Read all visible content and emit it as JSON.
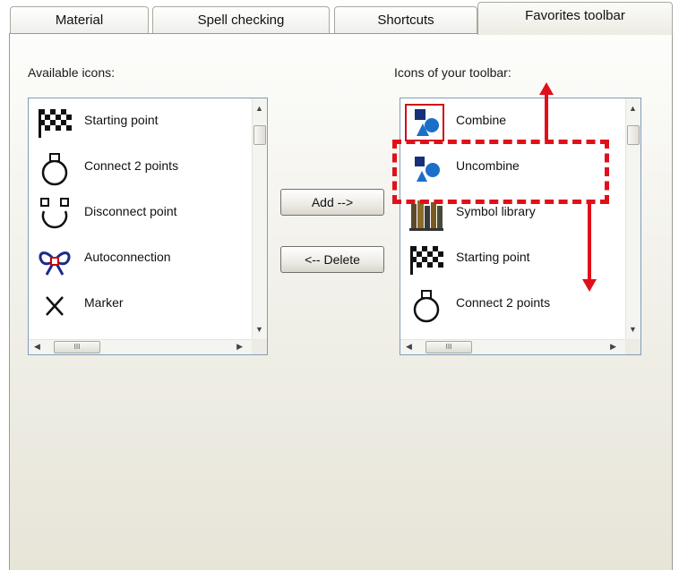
{
  "tabs": [
    {
      "label": "Material",
      "active": false
    },
    {
      "label": "Spell checking",
      "active": false
    },
    {
      "label": "Shortcuts",
      "active": false
    },
    {
      "label": "Favorites toolbar",
      "active": true
    }
  ],
  "available": {
    "label": "Available icons:",
    "items": [
      {
        "label": "Starting point",
        "icon": "checkered-flag-icon"
      },
      {
        "label": "Connect 2 points",
        "icon": "connect-points-icon"
      },
      {
        "label": "Disconnect point",
        "icon": "disconnect-point-icon"
      },
      {
        "label": "Autoconnection",
        "icon": "autoconnection-icon"
      },
      {
        "label": "Marker",
        "icon": "marker-x-icon"
      }
    ]
  },
  "toolbar": {
    "label": "Icons of your toolbar:",
    "items": [
      {
        "label": "Combine",
        "icon": "combine-shapes-icon"
      },
      {
        "label": "Uncombine",
        "icon": "uncombine-shapes-icon"
      },
      {
        "label": "Symbol library",
        "icon": "books-icon"
      },
      {
        "label": "Starting point",
        "icon": "checkered-flag-icon"
      },
      {
        "label": "Connect 2 points",
        "icon": "connect-points-icon"
      }
    ]
  },
  "buttons": {
    "add": "Add -->",
    "delete": "<-- Delete"
  },
  "scroll": {
    "hthumb_grip": "III"
  },
  "colors": {
    "annotation_red": "#e0101a",
    "combine_blue": "#1b6fc9",
    "combine_navy": "#16307a"
  }
}
